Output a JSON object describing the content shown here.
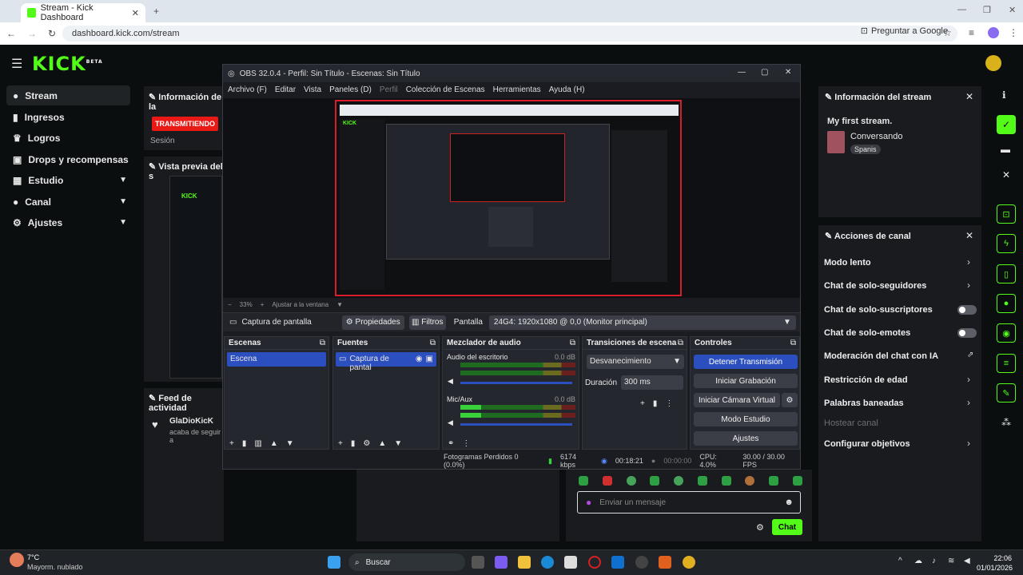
{
  "browser": {
    "tab_title": "Stream - Kick Dashboard",
    "url": "dashboard.kick.com/stream",
    "ask_google": "Preguntar a Google"
  },
  "kick": {
    "logo": "KICK",
    "logo_badge": "BETA",
    "nav": [
      {
        "label": "Stream",
        "icon": "dot-icon"
      },
      {
        "label": "Ingresos",
        "icon": "chart-icon"
      },
      {
        "label": "Logros",
        "icon": "trophy-icon"
      },
      {
        "label": "Drops y recompensas",
        "icon": "gift-icon"
      },
      {
        "label": "Estudio",
        "icon": "grid-icon"
      },
      {
        "label": "Canal",
        "icon": "person-icon"
      },
      {
        "label": "Ajustes",
        "icon": "gear-icon"
      }
    ],
    "info_title": "Información de la",
    "live_badge": "TRANSMITIENDO",
    "session_label": "Sesión",
    "preview_title": "Vista previa del s",
    "activity_title": "Feed de actividad",
    "activity_user": "GlaDioKicK",
    "activity_text": "acaba de seguir a",
    "stream_info_title": "Información del stream",
    "stream_name": "My first stream.",
    "stream_category": "Conversando",
    "stream_language": "Spanis",
    "channel_actions_title": "Acciones de canal",
    "channel_actions": [
      {
        "label": "Modo lento",
        "control": "chevron"
      },
      {
        "label": "Chat de solo-seguidores",
        "control": "chevron"
      },
      {
        "label": "Chat de solo-suscriptores",
        "control": "toggle"
      },
      {
        "label": "Chat de solo-emotes",
        "control": "toggle"
      },
      {
        "label": "Moderación del chat con IA",
        "control": "external"
      },
      {
        "label": "Restricción de edad",
        "control": "chevron"
      },
      {
        "label": "Palabras baneadas",
        "control": "chevron"
      },
      {
        "label": "Hostear canal",
        "control": "none"
      },
      {
        "label": "Configurar objetivos",
        "control": "chevron"
      }
    ],
    "chat_placeholder": "Enviar un mensaje",
    "chat_button": "Chat"
  },
  "obs": {
    "title": "OBS 32.0.4 - Perfil: Sin Título - Escenas: Sin Título",
    "menu": [
      "Archivo (F)",
      "Editar",
      "Vista",
      "Paneles (D)",
      "Perfil",
      "Colección de Escenas",
      "Herramientas",
      "Ayuda (H)"
    ],
    "zoom": "33%",
    "fit_label": "Ajustar a la ventana",
    "source_tab": "Captura de pantalla",
    "properties": "Propiedades",
    "filters": "Filtros",
    "screen_label": "Pantalla",
    "screen_value": "24G4: 1920x1080 @ 0,0 (Monitor principal)",
    "docks": {
      "scenes": "Escenas",
      "sources": "Fuentes",
      "mixer": "Mezclador de audio",
      "transitions": "Transiciones de escena",
      "controls": "Controles"
    },
    "scene_item": "Escena",
    "source_item": "Captura de pantal",
    "mixer_tracks": [
      {
        "name": "Audio del escritorio",
        "db": "0.0 dB"
      },
      {
        "name": "Mic/Aux",
        "db": "0.0 dB"
      }
    ],
    "meter_scale": [
      "-60",
      "-55",
      "-50",
      "-45",
      "-40",
      "-35",
      "-30",
      "-25",
      "-20",
      "-15",
      "-10",
      "-5",
      "0"
    ],
    "transition": "Desvanecimiento",
    "duration_label": "Duración",
    "duration_value": "300 ms",
    "controls": [
      "Detener Transmisión",
      "Iniciar Grabación",
      "Iniciar Cámara Virtual",
      "Modo Estudio",
      "Ajustes"
    ],
    "status": {
      "dropped": "Fotogramas Perdidos 0 (0.0%)",
      "kbps": "6174 kbps",
      "time": "00:18:21",
      "rec": "00:00:00",
      "cpu": "CPU: 4.0%",
      "fps": "30.00 / 30.00 FPS"
    }
  },
  "taskbar": {
    "weather_temp": "7°C",
    "weather_desc": "Mayorm. nublado",
    "search": "Buscar",
    "time": "22:06",
    "date": "01/01/2026"
  },
  "colors": {
    "kick_green": "#53fc18",
    "live_red": "#e91916",
    "obs_blue": "#2c4fc0"
  }
}
